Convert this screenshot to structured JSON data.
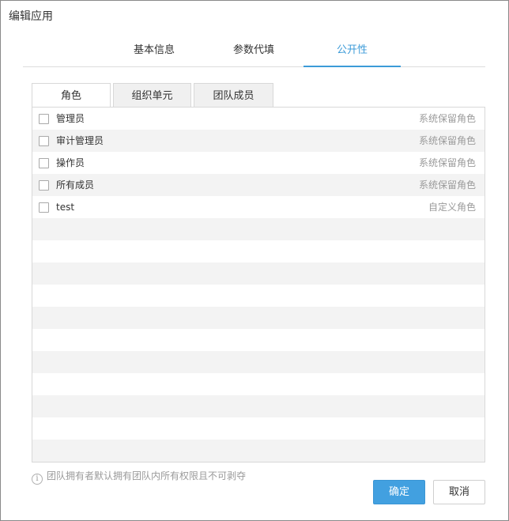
{
  "dialog": {
    "title": "编辑应用"
  },
  "top_tabs": [
    {
      "label": "基本信息",
      "active": false
    },
    {
      "label": "参数代填",
      "active": false
    },
    {
      "label": "公开性",
      "active": true
    }
  ],
  "sub_tabs": [
    {
      "label": "角色",
      "active": true
    },
    {
      "label": "组织单元",
      "active": false
    },
    {
      "label": "团队成员",
      "active": false
    }
  ],
  "roles": [
    {
      "name": "管理员",
      "type": "系统保留角色",
      "checked": false
    },
    {
      "name": "审计管理员",
      "type": "系统保留角色",
      "checked": false
    },
    {
      "name": "操作员",
      "type": "系统保留角色",
      "checked": false
    },
    {
      "name": "所有成员",
      "type": "系统保留角色",
      "checked": false
    },
    {
      "name": "test",
      "type": "自定义角色",
      "checked": false
    }
  ],
  "notice": {
    "icon": "info-icon",
    "text": "团队拥有者默认拥有团队内所有权限且不可剥夺"
  },
  "buttons": {
    "ok": "确定",
    "cancel": "取消"
  },
  "colors": {
    "accent": "#3c9bd8",
    "primary_button": "#42a0e0",
    "muted_text": "#9a9a9a"
  }
}
